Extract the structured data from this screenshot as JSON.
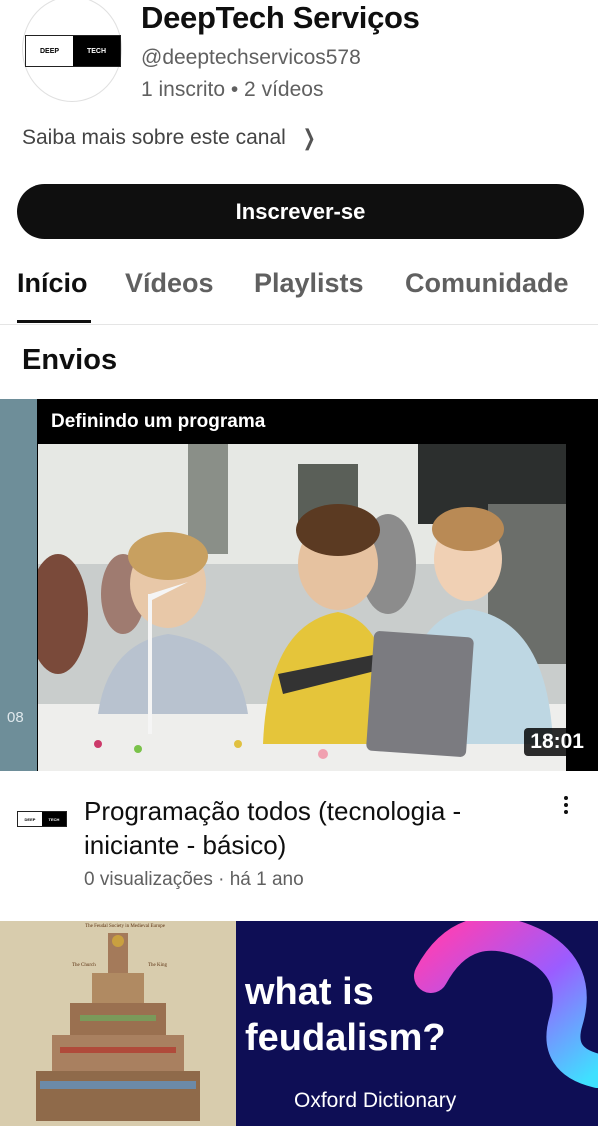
{
  "channel": {
    "logo_left": "DEEP",
    "logo_right": "TECH",
    "name": "DeepTech Serviços",
    "handle": "@deeptechservicos578",
    "stats": "1 inscrito • 2 vídeos",
    "about": "Saiba mais sobre este canal"
  },
  "subscribe_label": "Inscrever-se",
  "tabs": [
    {
      "label": "Início",
      "active": true
    },
    {
      "label": "Vídeos",
      "active": false
    },
    {
      "label": "Playlists",
      "active": false
    },
    {
      "label": "Comunidade",
      "active": false
    }
  ],
  "section_title": "Envios",
  "videos": [
    {
      "thumb_title": "Definindo um programa",
      "side_number": "08",
      "duration": "18:01",
      "channel_logo_left": "DEEP",
      "channel_logo_right": "TECH",
      "title": "Programação todos (tecnologia - iniciante - básico)",
      "meta": "0 visualizações · há 1 ano"
    },
    {
      "thumb_text_line1": "what is",
      "thumb_text_line2": "feudalism?",
      "thumb_caption": "Oxford Dictionary",
      "thumb_left_heading": "The Feudal Society in Medieval Europe",
      "thumb_left_labels": [
        "The Church",
        "The King"
      ]
    }
  ],
  "colors": {
    "subscribe_bg": "#0f0f0f",
    "side_strip": "#6e8e99",
    "navy": "#0e0e55",
    "parchment": "#d8ccad"
  },
  "icons": [
    "chevron-right-icon",
    "more-vert-icon"
  ]
}
